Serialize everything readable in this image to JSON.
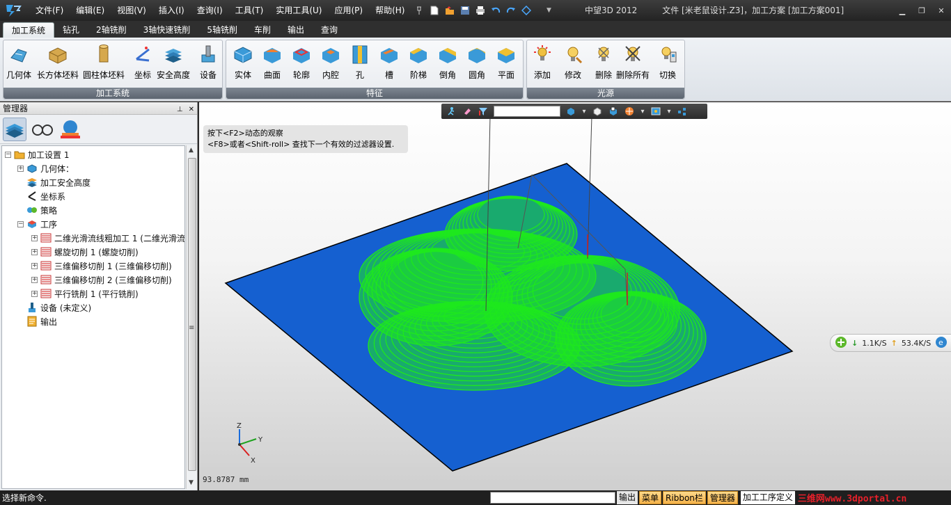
{
  "titlebar": {
    "app_title": "中望3D 2012",
    "document_title": "文件 [米老鼠设计.Z3]，加工方案 [加工方案001]"
  },
  "menu": [
    "文件(F)",
    "编辑(E)",
    "视图(V)",
    "插入(I)",
    "查询(I)",
    "工具(T)",
    "实用工具(U)",
    "应用(P)",
    "帮助(H)"
  ],
  "ribbon_tabs": [
    "加工系统",
    "钻孔",
    "2轴铣削",
    "3轴快速铣削",
    "5轴铣削",
    "车削",
    "输出",
    "查询"
  ],
  "ribbon_groups": {
    "machining": {
      "title": "加工系统",
      "buttons": [
        "几何体",
        "长方体坯料",
        "圆柱体坯料",
        "坐标",
        "安全高度",
        "设备"
      ]
    },
    "features": {
      "title": "特征",
      "buttons": [
        "实体",
        "曲面",
        "轮廓",
        "内腔",
        "孔",
        "槽",
        "阶梯",
        "倒角",
        "圆角",
        "平面"
      ]
    },
    "lights": {
      "title": "光源",
      "buttons": [
        "添加",
        "修改",
        "删除",
        "删除所有",
        "切换"
      ]
    }
  },
  "manager": {
    "title": "管理器",
    "tree": [
      {
        "label": "加工设置 1",
        "level": 0,
        "expander": "−",
        "icon": "folder-icon"
      },
      {
        "label": "几何体：",
        "level": 1,
        "expander": "+",
        "icon": "geometry-icon"
      },
      {
        "label": "加工安全高度",
        "level": 1,
        "expander": "",
        "icon": "safe-height-icon"
      },
      {
        "label": "坐标系",
        "level": 1,
        "expander": "",
        "icon": "coordinate-icon"
      },
      {
        "label": "策略",
        "level": 1,
        "expander": "",
        "icon": "strategy-icon"
      },
      {
        "label": "工序",
        "level": 1,
        "expander": "−",
        "icon": "operation-icon"
      },
      {
        "label": "二维光滑流线粗加工 1 (二维光滑流",
        "level": 2,
        "expander": "+",
        "icon": "toolpath-icon"
      },
      {
        "label": "螺旋切削 1 (螺旋切削)",
        "level": 2,
        "expander": "+",
        "icon": "toolpath-icon"
      },
      {
        "label": "三维偏移切削 1 (三维偏移切削)",
        "level": 2,
        "expander": "+",
        "icon": "toolpath-icon"
      },
      {
        "label": "三维偏移切削 2 (三维偏移切削)",
        "level": 2,
        "expander": "+",
        "icon": "toolpath-icon"
      },
      {
        "label": "平行铣削 1 (平行铣削)",
        "level": 2,
        "expander": "+",
        "icon": "toolpath-icon"
      },
      {
        "label": "设备 (未定义)",
        "level": 1,
        "expander": "",
        "icon": "machine-icon"
      },
      {
        "label": "输出",
        "level": 1,
        "expander": "",
        "icon": "output-icon"
      }
    ]
  },
  "viewport": {
    "hint_line1": "按下<F2>动态的观察",
    "hint_line2": "<F8>或者<Shift-roll> 查找下一个有效的过滤器设置.",
    "scale": "93.8787 mm",
    "axes": {
      "x": "X",
      "y": "Y",
      "z": "Z"
    },
    "filter_value": "",
    "colors": {
      "plate": "#1560d0",
      "toolpath": "#1ee81e",
      "plate_edge": "#000000"
    }
  },
  "network": {
    "down": "1.1K/S",
    "up": "53.4K/S"
  },
  "statusbar": {
    "message": "选择新命令.",
    "buttons": [
      "输出",
      "菜单",
      "Ribbon栏",
      "管理器"
    ],
    "operation": "加工工序定义",
    "watermark": "三维网www.3dportal.cn"
  }
}
